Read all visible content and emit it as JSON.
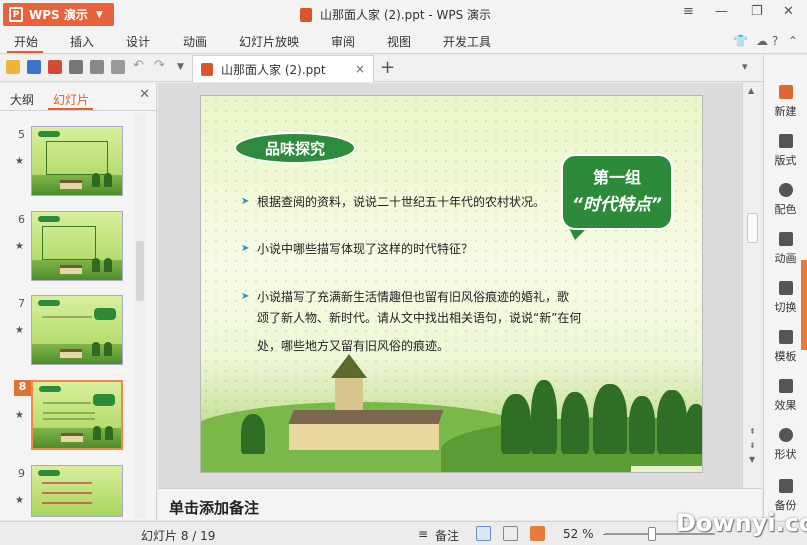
{
  "app": {
    "button_label": "WPS 演示",
    "logo_letter": "P",
    "title": "山那面人家 (2).ppt - WPS 演示"
  },
  "window_controls": {
    "menu": "≡",
    "minimize": "—",
    "restore": "❐",
    "close": "✕"
  },
  "menubar": {
    "items": [
      "开始",
      "插入",
      "设计",
      "动画",
      "幻灯片放映",
      "审阅",
      "视图",
      "开发工具"
    ],
    "active_index": 0,
    "right_icons": [
      "shirt-icon",
      "cloud-user-icon",
      "help-icon",
      "collapse-icon"
    ]
  },
  "toolbar": {
    "icons": [
      "open-icon",
      "save-icon",
      "export-pdf-icon",
      "print-icon",
      "print-preview-icon",
      "print-setup-icon",
      "undo-icon",
      "redo-icon",
      "more-icon"
    ],
    "doc_tab": {
      "label": "山那面人家 (2).ppt",
      "close": "×"
    },
    "new_tab": "+"
  },
  "left_panel": {
    "tabs": [
      "大纲",
      "幻灯片"
    ],
    "active_tab": 1,
    "close": "✕",
    "thumbnails": [
      {
        "number": "5",
        "star": "★"
      },
      {
        "number": "6",
        "star": "★"
      },
      {
        "number": "7",
        "star": "★"
      },
      {
        "number": "8",
        "star": "★"
      },
      {
        "number": "9",
        "star": "★"
      }
    ],
    "selected_index": 3
  },
  "slide": {
    "title_badge": "品味探究",
    "bubble_line1": "第一组",
    "bubble_line2": "“时代特点”",
    "bullets": [
      "根据查阅的资料，说说二十世纪五十年代的农村状况。",
      "小说中哪些描写体现了这样的时代特征？",
      "小说描写了充满新生活情趣但也留有旧风俗痕迹的婚礼，歌",
      "颂了新人物、新时代。请从文中找出相关语句，说说“新”在何",
      "处，哪些地方又留有旧风俗的痕迹。"
    ],
    "bullet_arrow": "➤"
  },
  "notes": {
    "placeholder": "单击添加备注"
  },
  "right_panel": {
    "items": [
      "新建",
      "版式",
      "配色",
      "动画",
      "切换",
      "模板",
      "效果",
      "形状",
      "备份"
    ]
  },
  "statusbar": {
    "slide_indicator": "幻灯片 8 / 19",
    "notes_label": "备注",
    "zoom": "52 %",
    "zoom_minus": "—",
    "view_icons": [
      "normal-view-icon",
      "slide-sorter-icon",
      "slideshow-icon"
    ]
  },
  "watermark": "Downyi.com"
}
